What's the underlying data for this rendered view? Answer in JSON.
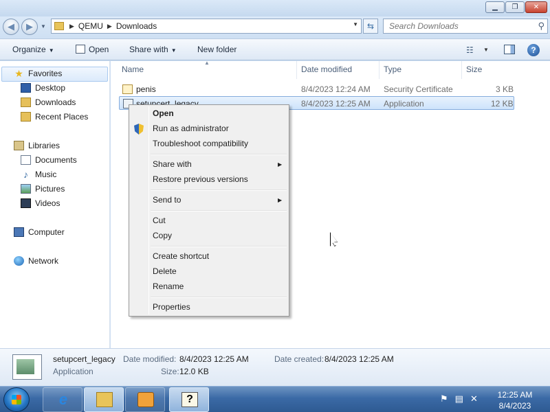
{
  "window": {
    "minimize_glyph": "▁",
    "maximize_glyph": "❐",
    "close_glyph": "✕"
  },
  "address": {
    "crumbs": [
      "QEMU",
      "Downloads"
    ],
    "search_placeholder": "Search Downloads"
  },
  "toolbar": {
    "organize": "Organize",
    "open": "Open",
    "share_with": "Share with",
    "new_folder": "New folder"
  },
  "nav": {
    "favorites": "Favorites",
    "desktop": "Desktop",
    "downloads": "Downloads",
    "recent_places": "Recent Places",
    "libraries": "Libraries",
    "documents": "Documents",
    "music": "Music",
    "pictures": "Pictures",
    "videos": "Videos",
    "computer": "Computer",
    "network": "Network"
  },
  "columns": {
    "name": "Name",
    "date_modified": "Date modified",
    "type": "Type",
    "size": "Size"
  },
  "files": [
    {
      "name": "penis",
      "date": "8/4/2023 12:24 AM",
      "type": "Security Certificate",
      "size": "3 KB",
      "icon": "certificate-icon"
    },
    {
      "name": "setupcert_legacy",
      "date": "8/4/2023 12:25 AM",
      "type": "Application",
      "size": "12 KB",
      "icon": "application-icon"
    }
  ],
  "context_menu": {
    "open": "Open",
    "run_as_admin": "Run as administrator",
    "troubleshoot": "Troubleshoot compatibility",
    "share_with": "Share with",
    "restore_versions": "Restore previous versions",
    "send_to": "Send to",
    "cut": "Cut",
    "copy": "Copy",
    "create_shortcut": "Create shortcut",
    "delete": "Delete",
    "rename": "Rename",
    "properties": "Properties"
  },
  "details": {
    "name": "setupcert_legacy",
    "type": "Application",
    "date_modified_label": "Date modified:",
    "date_modified": "8/4/2023 12:25 AM",
    "date_created_label": "Date created:",
    "date_created": "8/4/2023 12:25 AM",
    "size_label": "Size:",
    "size": "12.0 KB"
  },
  "taskbar": {
    "time": "12:25 AM",
    "date": "8/4/2023",
    "help_glyph": "?"
  },
  "colors": {
    "selection": "#cde3fb",
    "taskbar": "#3b6aa6",
    "menu_bg": "#f0f0f0"
  }
}
